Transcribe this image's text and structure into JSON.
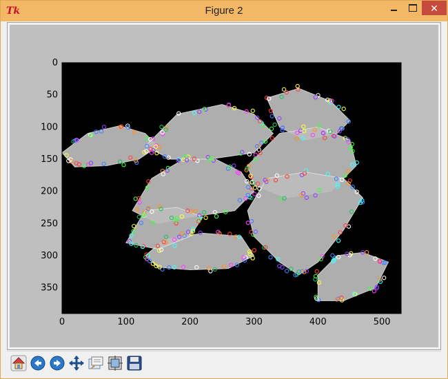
{
  "window": {
    "title": "Figure 2",
    "app_icon_text": "Tk"
  },
  "toolbar": {
    "buttons": [
      {
        "name": "home",
        "icon": "home-icon"
      },
      {
        "name": "back",
        "icon": "back-arrow-icon"
      },
      {
        "name": "forward",
        "icon": "forward-arrow-icon"
      },
      {
        "name": "pan",
        "icon": "pan-icon"
      },
      {
        "name": "zoom",
        "icon": "zoom-to-rect-icon"
      },
      {
        "name": "subplots",
        "icon": "configure-subplots-icon"
      },
      {
        "name": "save",
        "icon": "save-icon"
      }
    ]
  },
  "chart_data": {
    "type": "image",
    "title": "",
    "xlabel": "",
    "ylabel": "",
    "xlim": [
      0,
      530
    ],
    "ylim": [
      390,
      0
    ],
    "x_ticks": [
      0,
      100,
      200,
      300,
      400,
      500
    ],
    "y_ticks": [
      0,
      50,
      100,
      150,
      200,
      250,
      300,
      350
    ],
    "x_tick_labels": [
      "0",
      "100",
      "200",
      "300",
      "400",
      "500"
    ],
    "y_tick_labels": [
      "0",
      "50",
      "100",
      "150",
      "200",
      "250",
      "300",
      "350"
    ],
    "description_colors": {
      "canvas": "#bfbfbf",
      "image_bg": "#000000",
      "leaf_fill": "#bdbdbd"
    },
    "keypoint_colors": [
      "#ff4040",
      "#40ff40",
      "#4080ff",
      "#ffff40",
      "#ff40ff",
      "#40ffff",
      "#ff9020",
      "#9040ff",
      "#20c060",
      "#ffffff"
    ]
  }
}
